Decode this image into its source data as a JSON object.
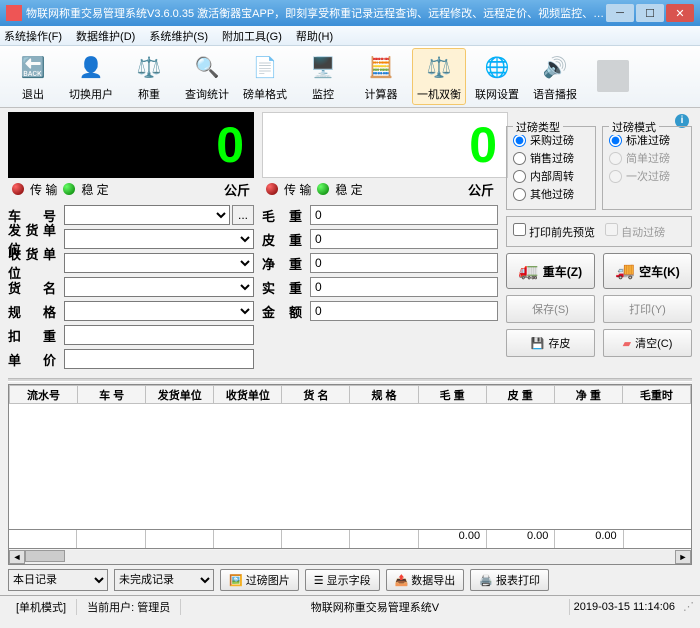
{
  "window": {
    "title": "物联网称重交易管理系统V3.6.0.35 激活衡器宝APP，即刻享受称重记录远程查询、远程修改、远程定价、视频监控、订单查询、称重作弊报警和称重审核等功..."
  },
  "menu": {
    "items": [
      "系统操作(F)",
      "数据维护(D)",
      "系统维护(S)",
      "附加工具(G)",
      "帮助(H)"
    ]
  },
  "toolbar": {
    "items": [
      "退出",
      "切换用户",
      "称重",
      "查询统计",
      "磅单格式",
      "监控",
      "计算器",
      "一机双衡",
      "联网设置",
      "语音播报",
      ""
    ]
  },
  "left": {
    "weight": "0",
    "transmit": "传 输",
    "stable": "稳 定",
    "unit": "公斤",
    "fields": {
      "car": "车  号",
      "sender": "发货单位",
      "receiver": "收货单位",
      "goods": "货  名",
      "spec": "规  格",
      "deduct": "扣  重",
      "price": "单  价"
    }
  },
  "mid": {
    "weight": "0",
    "transmit": "传 输",
    "stable": "稳 定",
    "unit": "公斤",
    "fields": {
      "gross": "毛  重",
      "gross_v": "0",
      "tare": "皮  重",
      "tare_v": "0",
      "net": "净  重",
      "net_v": "0",
      "real": "实  重",
      "real_v": "0",
      "amount": "金  额",
      "amount_v": "0"
    }
  },
  "right": {
    "info_icon": "ⓘ",
    "g1": {
      "title": "过磅类型",
      "r1": "采购过磅",
      "r2": "销售过磅",
      "r3": "内部周转",
      "r4": "其他过磅"
    },
    "g2": {
      "title": "过磅模式",
      "r1": "标准过磅",
      "r2": "简单过磅",
      "r3": "一次过磅"
    },
    "chk1": "打印前先预览",
    "chk2": "自动过磅",
    "btn_heavy": "重车(Z)",
    "btn_empty": "空车(K)",
    "btn_save": "保存(S)",
    "btn_print": "打印(Y)",
    "btn_tare": "存皮",
    "btn_clear": "清空(C)"
  },
  "table": {
    "cols": [
      "流水号",
      "车  号",
      "发货单位",
      "收货单位",
      "货  名",
      "规  格",
      "毛  重",
      "皮  重",
      "净  重",
      "毛重时"
    ],
    "sums": [
      "",
      "",
      "",
      "",
      "",
      "",
      "0.00",
      "0.00",
      "0.00",
      ""
    ]
  },
  "bottom": {
    "sel1": "本日记录",
    "sel2": "未完成记录",
    "b1": "过磅图片",
    "b2": "显示字段",
    "b3": "数据导出",
    "b4": "报表打印"
  },
  "status": {
    "mode": "[单机模式]",
    "user": "当前用户: 管理员",
    "sys": "物联网称重交易管理系统V",
    "time": "2019-03-15 11:14:06"
  }
}
